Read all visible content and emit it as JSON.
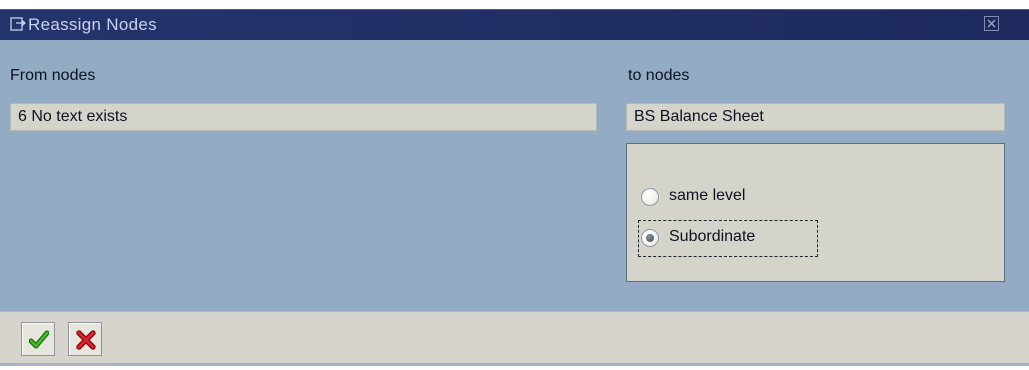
{
  "window": {
    "title": "Reassign Nodes"
  },
  "form": {
    "from_label": "From nodes",
    "from_value": "6 No text exists",
    "to_label": "to nodes",
    "to_value": "BS Balance Sheet"
  },
  "options": {
    "items": [
      {
        "label": "same level",
        "selected": false
      },
      {
        "label": "Subordinate",
        "selected": true
      }
    ]
  },
  "toolbar": {
    "confirm_icon": "green-checkmark-icon",
    "cancel_icon": "red-x-icon"
  },
  "colors": {
    "title_bar": "#24346c",
    "content_bg": "#93abc3",
    "field_bg": "#d5d4cb",
    "confirm_green": "#2f9d1f",
    "cancel_red": "#d0121a"
  }
}
